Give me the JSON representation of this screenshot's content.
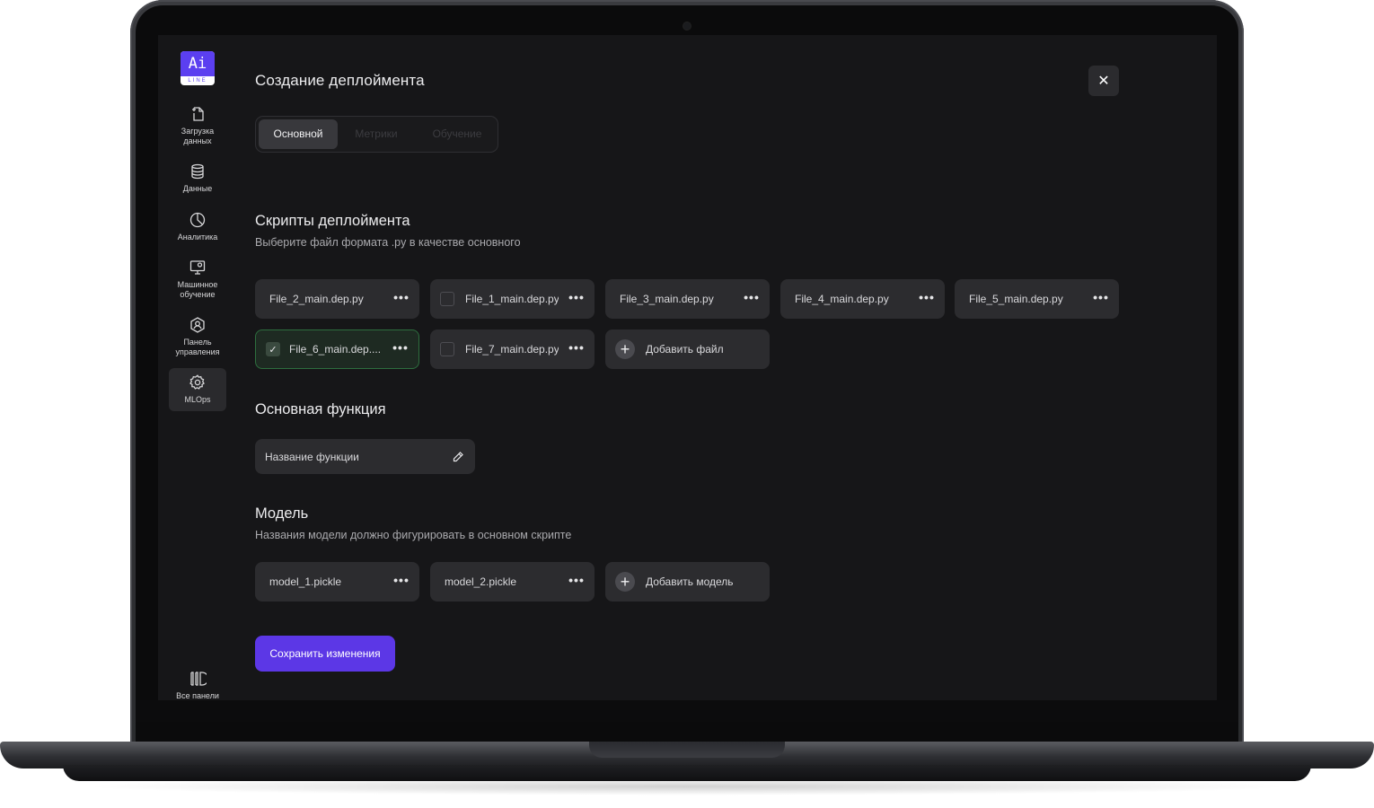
{
  "colors": {
    "accent": "#5c37e6",
    "screen_bg": "#161618",
    "chip_bg": "#2c2c2f",
    "checked_border": "#2d6e3e"
  },
  "logo": {
    "top": "Ai",
    "bottom": "LINE"
  },
  "sidebar": {
    "items": [
      {
        "icon": "upload-file-icon",
        "label": "Загрузка\nданных"
      },
      {
        "icon": "database-icon",
        "label": "Данные"
      },
      {
        "icon": "pie-chart-icon",
        "label": "Аналитика"
      },
      {
        "icon": "monitor-ml-icon",
        "label": "Машинное\nобучение"
      },
      {
        "icon": "user-panel-icon",
        "label": "Панель\nуправления"
      },
      {
        "icon": "gear-icon",
        "label": "MLOps",
        "active": true
      }
    ],
    "all_panels": {
      "icon": "panels-icon",
      "label": "Все панели"
    }
  },
  "header": {
    "title": "Создание деплоймента",
    "close_icon": "close-icon"
  },
  "tabs": [
    {
      "label": "Основной",
      "active": true
    },
    {
      "label": "Метрики",
      "active": false
    },
    {
      "label": "Обучение",
      "active": false
    }
  ],
  "scripts": {
    "title": "Скрипты деплоймента",
    "subtitle": "Выберите файл формата .py в качестве основного",
    "files": [
      {
        "name": "File_2_main.dep.py",
        "checkbox": false
      },
      {
        "name": "File_1_main.dep.py",
        "checkbox": true,
        "checked": false
      },
      {
        "name": "File_3_main.dep.py",
        "checkbox": false
      },
      {
        "name": "File_4_main.dep.py",
        "checkbox": false
      },
      {
        "name": "File_5_main.dep.py",
        "checkbox": false
      },
      {
        "name": "File_6_main.dep....",
        "checkbox": true,
        "checked": true
      },
      {
        "name": "File_7_main.dep.py",
        "checkbox": true,
        "checked": false
      }
    ],
    "add_label": "Добавить файл"
  },
  "function": {
    "title": "Основная функция",
    "input_label": "Название функции",
    "edit_icon": "pencil-icon"
  },
  "model": {
    "title": "Модель",
    "subtitle": "Названия модели должно фигурировать в основном скрипте",
    "files": [
      {
        "name": "model_1.pickle"
      },
      {
        "name": "model_2.pickle"
      }
    ],
    "add_label": "Добавить модель"
  },
  "save_button": "Сохранить изменения",
  "menu_glyph": "•••",
  "check_glyph": "✓",
  "plus_glyph": "+",
  "close_glyph": "✕"
}
